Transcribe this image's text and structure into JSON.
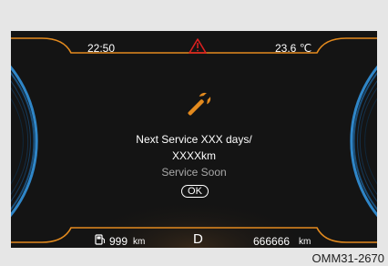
{
  "status_bar": {
    "time": "22:50",
    "temperature": "23.6 ℃",
    "warning_icon": "warning-triangle-icon"
  },
  "message": {
    "icon": "wrench-icon",
    "line1": "Next Service XXX days/",
    "line2": "XXXXkm",
    "line3": "Service Soon",
    "ok_label": "OK"
  },
  "bottom_bar": {
    "fuel_icon": "fuel-pump-icon",
    "range_value": "999",
    "range_unit": "km",
    "gear": "D",
    "odometer_value": "666666",
    "odometer_unit": "km"
  },
  "figure_id": "OMM31-2670",
  "colors": {
    "accent_orange": "#e38a1e",
    "gauge_blue": "#2f86c8",
    "warning_red": "#e02020"
  }
}
